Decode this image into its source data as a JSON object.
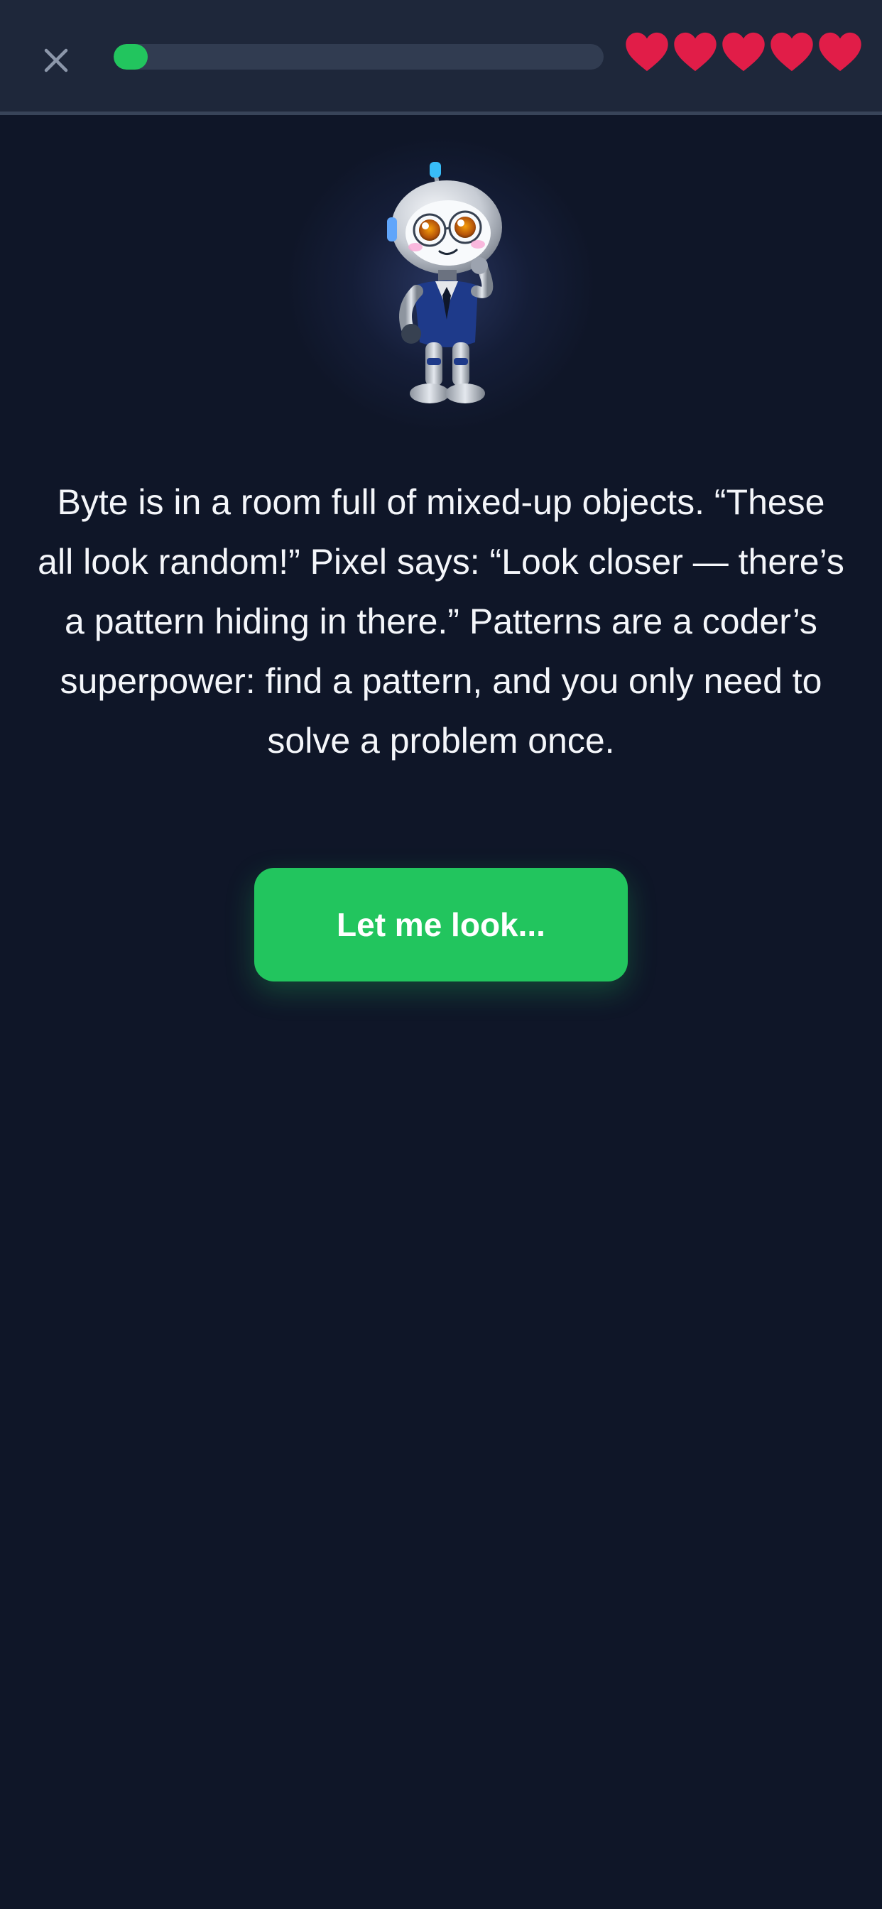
{
  "header": {
    "close_icon": "close-icon",
    "progress_fraction": 0.07,
    "progress_color": "#22c55e",
    "lives": {
      "count": 5,
      "icon": "heart-icon",
      "color": "#e11d48"
    }
  },
  "mascot": {
    "icon": "robot-mascot-icon"
  },
  "story": {
    "text": "Byte is in a room full of mixed-up objects. “These all look random!” Pixel says: “Look closer — there’s a pattern hiding in there.” Patterns are a coder’s superpower: find a pattern, and you only need to solve a problem once."
  },
  "continue_button": {
    "label": "Let me look..."
  },
  "colors": {
    "background": "#0f1628",
    "header_bg": "#1e273a",
    "accent": "#22c55e",
    "heart": "#e11d48"
  }
}
